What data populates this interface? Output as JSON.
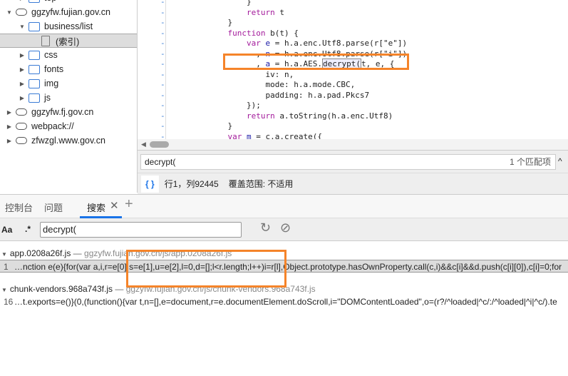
{
  "sidebar": {
    "items": [
      {
        "label": "top",
        "icon": "folder-icon"
      },
      {
        "label": "ggzyfw.fujian.gov.cn",
        "icon": "cloud-icon",
        "expanded": true
      },
      {
        "label": "business/list",
        "icon": "folder-icon",
        "expanded": true
      },
      {
        "label": "(索引)",
        "icon": "file-icon",
        "selected": true
      },
      {
        "label": "css",
        "icon": "folder-icon"
      },
      {
        "label": "fonts",
        "icon": "folder-icon"
      },
      {
        "label": "img",
        "icon": "folder-icon"
      },
      {
        "label": "js",
        "icon": "folder-icon"
      },
      {
        "label": "ggzyfw.fj.gov.cn",
        "icon": "cloud-icon"
      },
      {
        "label": "webpack://",
        "icon": "cloud-icon"
      },
      {
        "label": "zfwzgl.www.gov.cn",
        "icon": "cloud-icon"
      }
    ]
  },
  "editor": {
    "gutter_marker": "-",
    "lines": [
      "        }",
      "        return t",
      "    }",
      "    function b(t) {",
      "        var e = h.a.enc.Utf8.parse(r[\"e\"])",
      "          , n = h.a.enc.Utf8.parse(r[\"i\"])",
      "          , a = h.a.AES.decrypt(t, e, {",
      "            iv: n,",
      "            mode: h.a.mode.CBC,",
      "            padding: h.a.pad.Pkcs7",
      "        });",
      "        return a.toString(h.a.enc.Utf8)",
      "    }",
      "    var m = c.a.create({"
    ]
  },
  "find": {
    "value": "decrypt(",
    "match_count": "1 个匹配项"
  },
  "status": {
    "format_icon": "{ }",
    "position": "行1，列92445",
    "coverage": "覆盖范围: 不适用"
  },
  "drawer": {
    "tabs": [
      "控制台",
      "问题",
      "搜索"
    ],
    "active": "搜索"
  },
  "search": {
    "case_label": "Aa",
    "regex_label": ".*",
    "value": "decrypt("
  },
  "results": [
    {
      "file": "app.0208a26f.js",
      "sep": "—",
      "url": "ggzyfw.fujian.gov.cn/js/app.0208a26f.js",
      "line": "1",
      "text": "…nction e(e){for(var a,i,r=e[0],s=e[1],u=e[2],l=0,d=[];l<r.length;l++)i=r[l],Object.prototype.hasOwnProperty.call(c,i)&&c[i]&&d.push(c[i][0]),c[i]=0;for"
    },
    {
      "file": "chunk-vendors.968a743f.js",
      "sep": "—",
      "url": "ggzyfw.fujian.gov.cn/js/chunk-vendors.968a743f.js",
      "line": "16",
      "text": "…t.exports=e()}(0,(function(){var t,n=[],e=document,r=e.documentElement.doScroll,i=\"DOMContentLoaded\",o=(r?/^loaded|^c/:/^loaded|^i|^c/).te"
    }
  ],
  "colors": {
    "accent": "#1a73e8",
    "highlight": "#f5842a"
  }
}
